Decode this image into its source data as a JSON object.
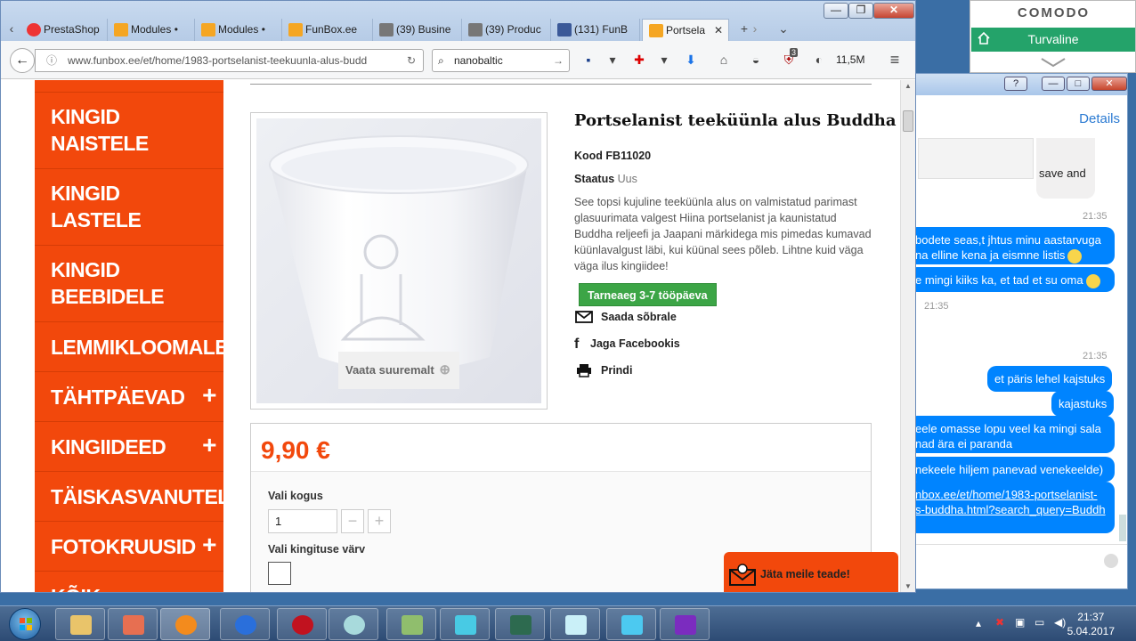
{
  "comodo": {
    "title": "COMODO",
    "status": "Turvaline"
  },
  "chat": {
    "details_label": "Details",
    "save_text": "save and",
    "messages": [
      {
        "time": "21:35",
        "text": "bodete seas,t jhtus minu aastarvuga",
        "text2": "na elline kena ja eismne listis"
      },
      {
        "text": "e mingi kiiks ka, et tad et su oma"
      },
      {
        "time": "21:35"
      },
      {
        "time": "21:35"
      },
      {
        "text": "et päris lehel kajstuks"
      },
      {
        "text": "kajastuks"
      },
      {
        "text": "eele omasse lopu veel ka mingi sala",
        "text2": "nad ära ei paranda"
      },
      {
        "text": "nekeele hiljem panevad venekeelde)"
      },
      {
        "link1": "nbox.ee/et/home/1983-portselanist-",
        "link2": "s-buddha.html?search_query=Buddh"
      }
    ]
  },
  "browser": {
    "tabs": [
      {
        "label": "PrestaShop",
        "color": "#ccc"
      },
      {
        "label": "Modules •",
        "color": "#f5a623"
      },
      {
        "label": "Modules •",
        "color": "#f5a623"
      },
      {
        "label": "FunBox.ee",
        "color": "#f5a623"
      },
      {
        "label": "(39) Busine",
        "color": "#888"
      },
      {
        "label": "(39) Produc",
        "color": "#888"
      },
      {
        "label": "(131) FunB",
        "color": "#3b5998"
      },
      {
        "label": "Portsela",
        "color": "#f5a623"
      }
    ],
    "url": "www.funbox.ee/et/home/1983-portselanist-teekuunla-alus-budd",
    "search_value": "nanobaltic",
    "badge_count": "3",
    "mem_label": "11,5M"
  },
  "menu": {
    "items": [
      {
        "line1": "KINGID",
        "line2": "NAISTELE",
        "plus": ""
      },
      {
        "line1": "KINGID",
        "line2": "LASTELE",
        "plus": ""
      },
      {
        "line1": "KINGID",
        "line2": "BEEBIDELE",
        "plus": ""
      },
      {
        "line1": "LEMMIKLOOMALE",
        "line2": "",
        "plus": ""
      },
      {
        "line1": "TÄHTPÄEVAD",
        "line2": "",
        "plus": "+"
      },
      {
        "line1": "KINGIIDEED",
        "line2": "",
        "plus": "+"
      },
      {
        "line1": "TÄISKASVANUTELE",
        "line2": "",
        "plus": ""
      },
      {
        "line1": "FOTOKRUUSID",
        "line2": "",
        "plus": "+"
      },
      {
        "line1": "KÕIK",
        "line2": "",
        "plus": ""
      }
    ]
  },
  "product": {
    "zoom_label": "Vaata suuremalt",
    "title": "Portselanist teeküünla alus Buddha",
    "code": "Kood FB11020",
    "status_label": "Staatus",
    "status_value": "Uus",
    "description": "See topsi kujuline teeküünla alus on valmistatud parimast glasuurimata valgest Hiina portselanist ja kaunistatud Buddha reljeefi ja Jaapani märkidega mis pimedas kumavad küünlavalgust läbi, kui küünal sees põleb. Lihtne kuid väga väga ilus kingiidee!",
    "delivery_badge": "Tarneaeg 3-7 tööpäeva",
    "send_friend": "Saada sõbrale",
    "share_fb": "Jaga Facebookis",
    "print": "Prindi",
    "price": "9,90 €",
    "qty_label": "Vali kogus",
    "qty_value": "1",
    "color_label": "Vali kingituse värv",
    "feedback_label": "Jäta meile teade!"
  },
  "taskbar": {
    "time": "21:37",
    "date": "5.04.2017"
  }
}
